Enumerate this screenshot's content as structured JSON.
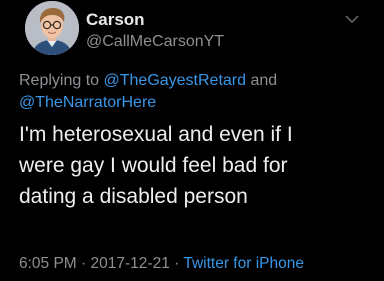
{
  "tweet": {
    "display_name": "Carson",
    "handle": "@CallMeCarsonYT",
    "reply": {
      "prefix": "Replying to",
      "mention_1": "@TheGayestRetard",
      "conjunction": "and",
      "mention_2": "@TheNarratorHere"
    },
    "body_lines": [
      "I'm heterosexual and even if I",
      "were gay I would feel bad for",
      "dating a disabled person"
    ],
    "time": "6:05 PM",
    "date": "2017-12-21",
    "separator": "·",
    "source": "Twitter for iPhone",
    "avatar_icon": "profile-photo",
    "menu_icon": "chevron-down-icon"
  },
  "colors": {
    "background": "#000000",
    "name": "#e8e8ea",
    "secondary": "#8d8f94",
    "link": "#3a96e6",
    "body": "#eceef0"
  }
}
